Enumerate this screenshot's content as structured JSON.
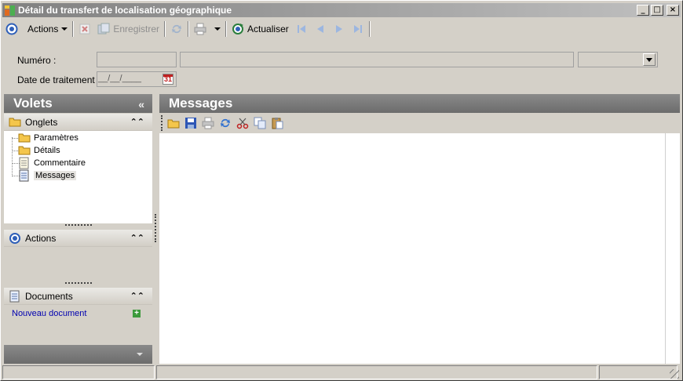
{
  "window": {
    "title": "Détail du transfert de localisation géographique",
    "minimize_label": "_",
    "maximize_label": "□",
    "close_label": "×"
  },
  "toolbar": {
    "actions_label": "Actions",
    "save_label": "Enregistrer",
    "refresh_label": "Actualiser"
  },
  "form": {
    "numero_label": "Numéro :",
    "numero_value": "",
    "numero_desc_value": "",
    "numero_select_value": "",
    "date_label": "Date de traitement :",
    "date_value": "__/__/____",
    "calendar_day": "31"
  },
  "left_panel": {
    "title": "Volets",
    "collapse_glyph": "«",
    "sections": {
      "onglets": {
        "label": "Onglets",
        "items": [
          {
            "label": "Paramètres",
            "icon": "folder-icon"
          },
          {
            "label": "Détails",
            "icon": "folder-icon"
          },
          {
            "label": "Commentaire",
            "icon": "document-icon"
          },
          {
            "label": "Messages",
            "icon": "document-icon",
            "selected": true
          }
        ]
      },
      "actions": {
        "label": "Actions"
      },
      "documents": {
        "label": "Documents",
        "new_document_link": "Nouveau document"
      }
    },
    "section_toggle_glyph": "⌃⌃"
  },
  "main_panel": {
    "title": "Messages",
    "toolbar_icons": [
      "open-folder-icon",
      "save-icon",
      "print-icon",
      "refresh-icon",
      "cut-icon",
      "copy-icon",
      "paste-icon"
    ]
  },
  "colors": {
    "window_bg": "#d4d0c8",
    "header_gray": "#7a7a7a",
    "link_blue": "#0000b0"
  }
}
